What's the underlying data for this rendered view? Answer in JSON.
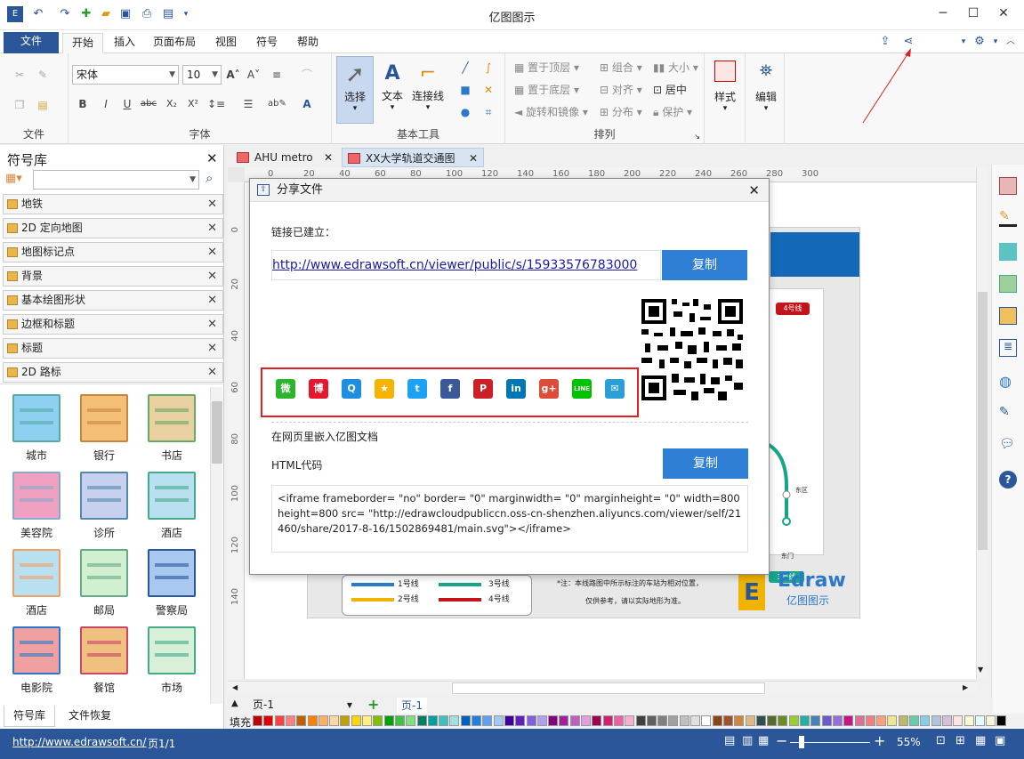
{
  "app": {
    "title": "亿图图示"
  },
  "ribbon_tabs": [
    "文件",
    "开始",
    "插入",
    "页面布局",
    "视图",
    "符号",
    "帮助"
  ],
  "ribbon": {
    "groups": {
      "file": "文件",
      "font": "字体",
      "basic_tools": "基本工具",
      "arrange": "排列"
    },
    "font_name": "宋体",
    "font_size": "10",
    "tools": {
      "select": "选择",
      "text": "文本",
      "connector": "连接线"
    },
    "arrange": {
      "front": "置于顶层",
      "back": "置于底层",
      "rotate": "旋转和镜像",
      "group": "组合",
      "align": "对齐",
      "distribute": "分布",
      "size": "大小",
      "center": "居中",
      "protect": "保护"
    },
    "style": "样式",
    "edit": "编辑"
  },
  "left_panel": {
    "title": "符号库",
    "libraries": [
      "地铁",
      "2D 定向地图",
      "地图标记点",
      "背景",
      "基本绘图形状",
      "边框和标题",
      "标题",
      "2D 路标"
    ],
    "symbols": [
      "城市",
      "银行",
      "书店",
      "美容院",
      "诊所",
      "酒店",
      "酒店",
      "邮局",
      "警察局",
      "电影院",
      "餐馆",
      "市场"
    ],
    "bottom_tabs": [
      "符号库",
      "文件恢复"
    ]
  },
  "doc_tabs": [
    "AHU metro",
    "XX大学轨道交通图"
  ],
  "ruler_h": [
    "0",
    "20",
    "40",
    "60",
    "80",
    "100",
    "120",
    "140",
    "160",
    "180",
    "200",
    "220",
    "240",
    "260",
    "280",
    "300"
  ],
  "ruler_v": [
    "0",
    "20",
    "40",
    "60",
    "80",
    "100",
    "120",
    "140"
  ],
  "diagram": {
    "lines": [
      "1号线",
      "2号线",
      "3号线",
      "4号线"
    ],
    "badges": [
      "4号线",
      "3号线"
    ],
    "note1": "*注：本线路图中所示标注的车站为相对位置，",
    "note2": "仅供参考，请以实际地形为准。",
    "logo": "Edraw",
    "logo_sub": "亿图图示",
    "station1": "东区",
    "station2": "东门"
  },
  "dialog": {
    "title": "分享文件",
    "link_created": "链接已建立：",
    "url": "http://www.edrawsoft.cn/viewer/public/s/15933576783000",
    "copy": "复制",
    "embed_label": "在网页里嵌入亿图文档",
    "html_label": "HTML代码",
    "code": "<iframe frameborder= \"no\" border= \"0\" marginwidth= \"0\" marginheight= \"0\" width=800 height=800 src= \"http://edrawcloudpubliccn.oss-cn-shenzhen.aliyuncs.com/viewer/self/21460/share/2017-8-16/1502869481/main.svg\"></iframe>",
    "social": [
      {
        "name": "wechat-icon",
        "color": "#2bb52b",
        "glyph": "微"
      },
      {
        "name": "weibo-icon",
        "color": "#e6162d",
        "glyph": "博"
      },
      {
        "name": "qq-icon",
        "color": "#1e8fe0",
        "glyph": "Q"
      },
      {
        "name": "qzone-icon",
        "color": "#f5b400",
        "glyph": "★"
      },
      {
        "name": "twitter-icon",
        "color": "#1da1f2",
        "glyph": "t"
      },
      {
        "name": "facebook-icon",
        "color": "#3b5998",
        "glyph": "f"
      },
      {
        "name": "pinterest-icon",
        "color": "#cb2027",
        "glyph": "P"
      },
      {
        "name": "linkedin-icon",
        "color": "#0077b5",
        "glyph": "in"
      },
      {
        "name": "googleplus-icon",
        "color": "#dd4b39",
        "glyph": "g+"
      },
      {
        "name": "line-icon",
        "color": "#00c300",
        "glyph": "LINE"
      },
      {
        "name": "email-icon",
        "color": "#2a9fd6",
        "glyph": "✉"
      }
    ]
  },
  "page_bar": {
    "page_select": "页-1",
    "page_tab": "页-1",
    "fill_label": "填充"
  },
  "status": {
    "url": "http://www.edrawsoft.cn/",
    "pages": "页1/1",
    "zoom": "55%"
  },
  "colors": {
    "brand": "#2b579a",
    "accent": "#2f7fd6",
    "annotation": "#e02020"
  }
}
